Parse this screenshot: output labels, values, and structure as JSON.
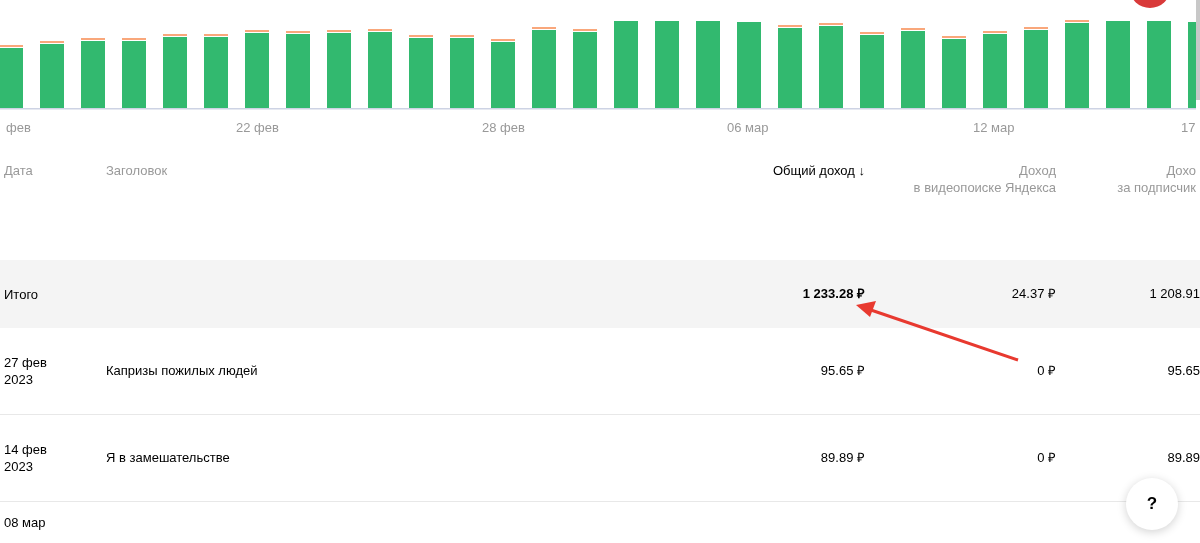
{
  "chart": {
    "axis_labels": [
      {
        "text": "фев",
        "kind": "start"
      },
      {
        "text": "22 фев",
        "kind": "mid"
      },
      {
        "text": "28 фев",
        "kind": "mid"
      },
      {
        "text": "06 мар",
        "kind": "mid"
      },
      {
        "text": "12 мар",
        "kind": "mid"
      },
      {
        "text": "17",
        "kind": "end"
      }
    ]
  },
  "table": {
    "columns": [
      {
        "label": "Дата",
        "sorted": false
      },
      {
        "label": "Заголовок",
        "sorted": false
      },
      {
        "label": "Общий доход",
        "sorted": true,
        "sort_icon": "↓"
      },
      {
        "label": "Доход",
        "sublabel": "в видеопоиске Яндекса",
        "sorted": false
      },
      {
        "label": "Дохо",
        "sublabel": "за подписчик",
        "sorted": false
      }
    ],
    "total": {
      "label": "Итого",
      "values": [
        "1 233.28 ₽",
        "24.37 ₽",
        "1 208.91"
      ]
    },
    "rows": [
      {
        "date": "27 фев 2023",
        "title": "Капризы пожилых людей",
        "values": [
          "95.65 ₽",
          "0 ₽",
          "95.65"
        ]
      },
      {
        "date": "14 фев 2023",
        "title": "Я в замешательстве",
        "values": [
          "89.89 ₽",
          "0 ₽",
          "89.89"
        ]
      },
      {
        "date": "08 мар"
      }
    ]
  },
  "help_button": {
    "label": "?"
  }
}
